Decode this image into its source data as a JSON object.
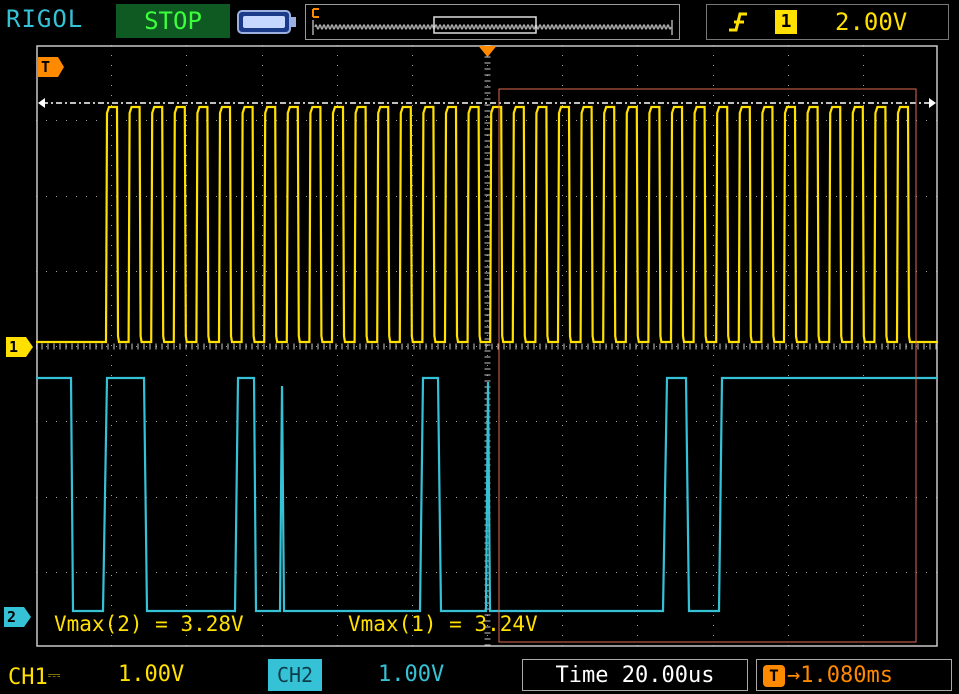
{
  "header": {
    "brand": "RIGOL",
    "run_state": "STOP",
    "trigger": {
      "edge_icon": "rising-edge-icon",
      "source": "1",
      "level": "2.00V"
    }
  },
  "markers": {
    "trigger_time": "T",
    "ch1": "1",
    "ch2": "2"
  },
  "measurements": [
    {
      "label": "Vmax(2)",
      "value": "3.28V"
    },
    {
      "label": "Vmax(1)",
      "value": "3.24V"
    }
  ],
  "footer": {
    "ch1_label": "CH1",
    "ch1_scale": "1.00V",
    "ch2_label": "CH2",
    "ch2_scale": "1.00V",
    "time_label": "Time",
    "time_scale": "20.00us",
    "trigger_offset": "1.080ms"
  },
  "colors": {
    "ch1": "#ffe000",
    "ch2": "#36c2d6",
    "trigger": "#ff8a00",
    "grid": "#c8c8c8",
    "selection": "#e06a50",
    "status_bg": "#0e5a22",
    "status_fg": "#3cff3c"
  }
}
